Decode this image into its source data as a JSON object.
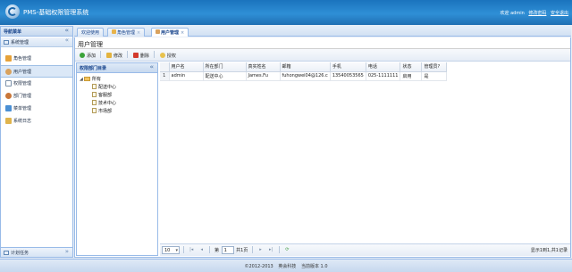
{
  "header": {
    "title": "PMS-基础权限管理系统",
    "welcome": "欢迎 admin",
    "change_password": "修改密码",
    "logout": "安全退出"
  },
  "sidebar": {
    "title": "导航菜单",
    "group": "系统管理",
    "items": [
      {
        "label": "角色管理",
        "icon": "role-icon"
      },
      {
        "label": "用户管理",
        "icon": "user-icon"
      },
      {
        "label": "权限管理",
        "icon": "permission-icon"
      },
      {
        "label": "部门管理",
        "icon": "department-icon"
      },
      {
        "label": "菜单管理",
        "icon": "menu-icon"
      },
      {
        "label": "系统日志",
        "icon": "log-icon"
      }
    ],
    "active_index": 1,
    "bottom_group": "计划任务"
  },
  "tabs": [
    {
      "label": "欢迎使用",
      "closable": false
    },
    {
      "label": "角色管理",
      "closable": true
    },
    {
      "label": "用户管理",
      "closable": true
    }
  ],
  "panel": {
    "title": "用户管理"
  },
  "toolbar": {
    "add": "添加",
    "edit": "修改",
    "delete": "删除",
    "grant": "授权"
  },
  "tree": {
    "title": "权限部门目录",
    "root": "所有",
    "children": [
      "配送中心",
      "客服部",
      "技术中心",
      "市场部"
    ]
  },
  "grid": {
    "columns": [
      "用户名",
      "所在部门",
      "真实姓名",
      "邮箱",
      "手机",
      "电话",
      "状态",
      "管理员?"
    ],
    "rows": [
      {
        "row_num": "1",
        "cells": [
          "admin",
          "配送中心",
          "James.Fu",
          "fuhongwei04@126.c",
          "13540053565",
          "025-1111111",
          "启用",
          "是"
        ]
      }
    ]
  },
  "pager": {
    "page_size": "10",
    "page_label": "第",
    "page_value": "1",
    "total_pages": "共1页",
    "info": "显示1到1,共1记录"
  },
  "footer": {
    "copyright": "©2012-2013",
    "company": "英会科技",
    "version": "当前版本 1.0"
  },
  "colors": {
    "header": "#2f8fd6",
    "border": "#99bbe8",
    "panel_title": "#15428b"
  }
}
